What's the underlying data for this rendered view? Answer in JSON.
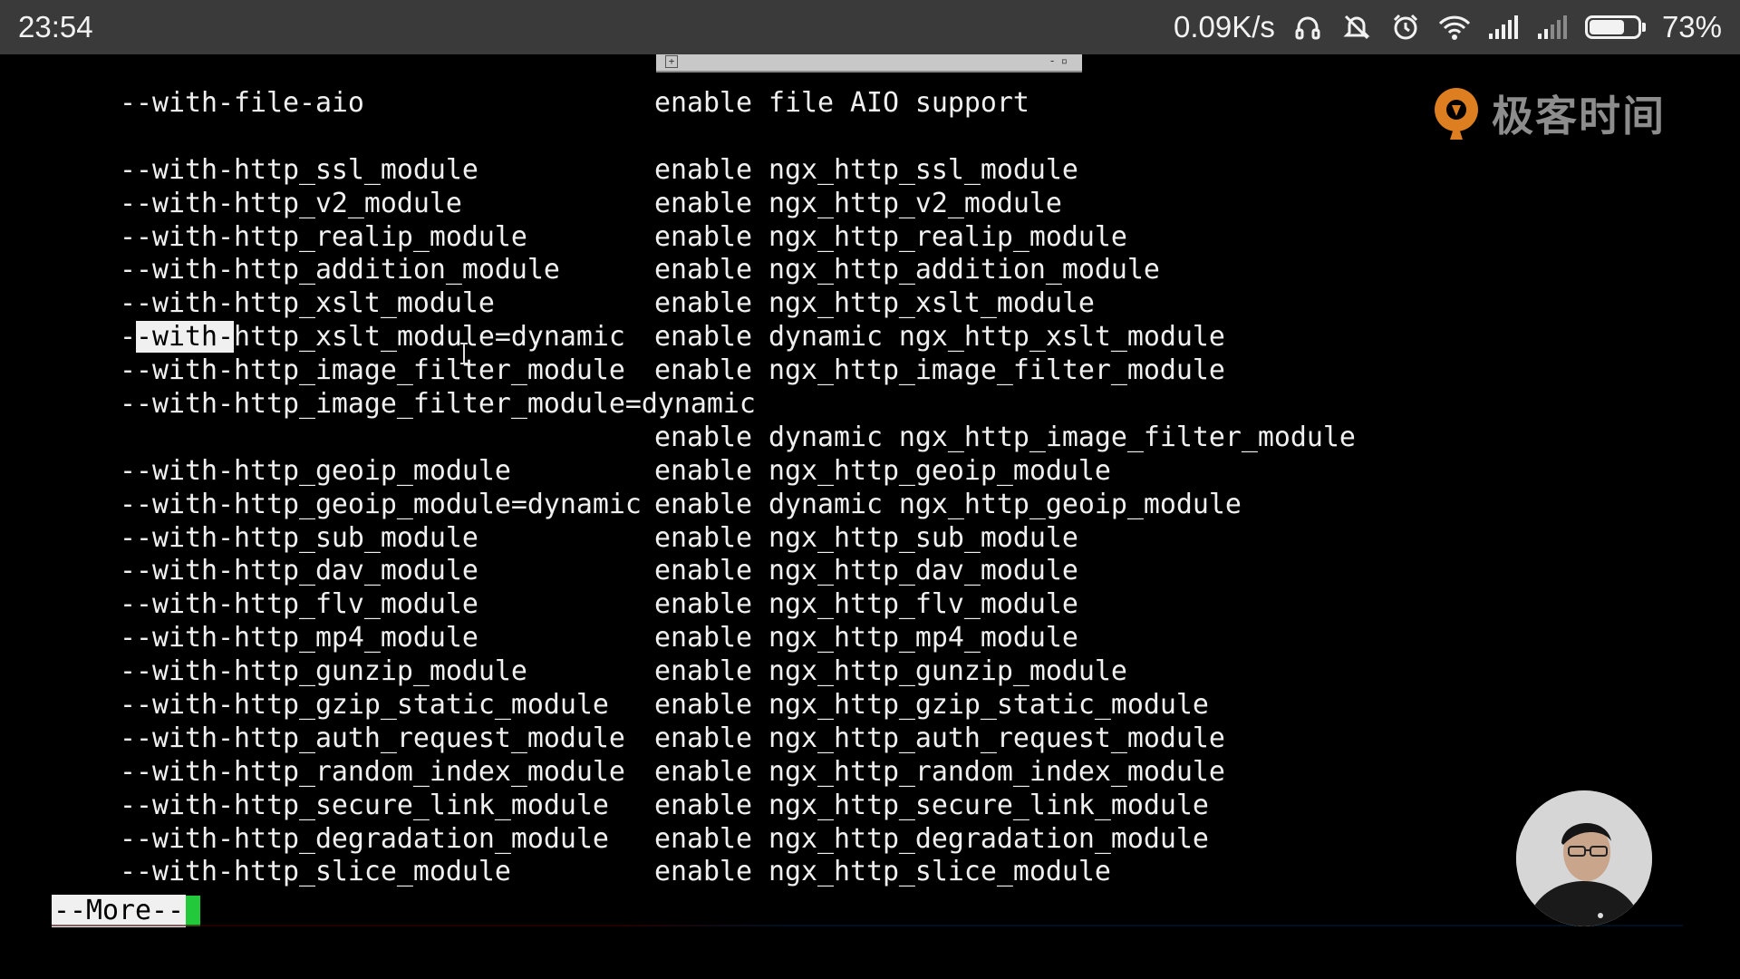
{
  "status_bar": {
    "time": "23:54",
    "net_speed": "0.09K/s",
    "battery_percent": "73%",
    "battery_level": 0.73,
    "icons": [
      "headset-icon",
      "mute-bell-icon",
      "alarm-icon",
      "wifi-icon",
      "signal-icon",
      "signal-weak-icon",
      "battery-icon"
    ]
  },
  "watermark": {
    "text": "极客时间",
    "logo_color": "#f08a24"
  },
  "terminal": {
    "lines": [
      {
        "opt": "  --with-file-aio",
        "desc": "enable file AIO support"
      },
      {
        "opt": "",
        "desc": ""
      },
      {
        "opt": "  --with-http_ssl_module",
        "desc": "enable ngx_http_ssl_module"
      },
      {
        "opt": "  --with-http_v2_module",
        "desc": "enable ngx_http_v2_module"
      },
      {
        "opt": "  --with-http_realip_module",
        "desc": "enable ngx_http_realip_module"
      },
      {
        "opt": "  --with-http_addition_module",
        "desc": "enable ngx_http_addition_module"
      },
      {
        "opt": "  --with-http_xslt_module",
        "desc": "enable ngx_http_xslt_module"
      },
      {
        "opt_pre": "  -",
        "opt_hl": "-with-",
        "opt_post": "http_xslt_module=dynamic",
        "desc": "enable dynamic ngx_http_xslt_module"
      },
      {
        "opt": "  --with-http_image_filter_module",
        "desc": "enable ngx_http_image_filter_module"
      },
      {
        "opt": "  --with-http_image_filter_module=dynamic",
        "desc": ""
      },
      {
        "opt": "",
        "desc": "enable dynamic ngx_http_image_filter_module"
      },
      {
        "opt": "  --with-http_geoip_module",
        "desc": "enable ngx_http_geoip_module"
      },
      {
        "opt": "  --with-http_geoip_module=dynamic",
        "desc": "enable dynamic ngx_http_geoip_module"
      },
      {
        "opt": "  --with-http_sub_module",
        "desc": "enable ngx_http_sub_module"
      },
      {
        "opt": "  --with-http_dav_module",
        "desc": "enable ngx_http_dav_module"
      },
      {
        "opt": "  --with-http_flv_module",
        "desc": "enable ngx_http_flv_module"
      },
      {
        "opt": "  --with-http_mp4_module",
        "desc": "enable ngx_http_mp4_module"
      },
      {
        "opt": "  --with-http_gunzip_module",
        "desc": "enable ngx_http_gunzip_module"
      },
      {
        "opt": "  --with-http_gzip_static_module",
        "desc": "enable ngx_http_gzip_static_module"
      },
      {
        "opt": "  --with-http_auth_request_module",
        "desc": "enable ngx_http_auth_request_module"
      },
      {
        "opt": "  --with-http_random_index_module",
        "desc": "enable ngx_http_random_index_module"
      },
      {
        "opt": "  --with-http_secure_link_module",
        "desc": "enable ngx_http_secure_link_module"
      },
      {
        "opt": "  --with-http_degradation_module",
        "desc": "enable ngx_http_degradation_module"
      },
      {
        "opt": "  --with-http_slice_module",
        "desc": "enable ngx_http_slice_module"
      }
    ],
    "more_prompt": "--More--"
  }
}
